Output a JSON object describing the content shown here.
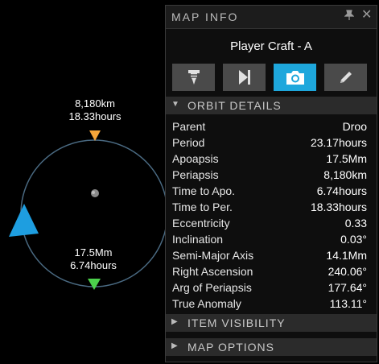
{
  "map": {
    "periapsis_label": {
      "distance": "8,180km",
      "time": "18.33hours"
    },
    "apoapsis_label": {
      "distance": "17.5Mm",
      "time": "6.74hours"
    },
    "colors": {
      "orbit_line": "#4a6a82",
      "periapsis_marker": "#f5a53a",
      "apoapsis_marker": "#4cd14c",
      "craft_marker": "#1e9ee0"
    }
  },
  "panel": {
    "title": "MAP INFO",
    "pin_icon": "pin-icon",
    "close_icon": "close-icon",
    "craft_name": "Player Craft - A",
    "tools": [
      {
        "icon": "drill-icon",
        "active": false
      },
      {
        "icon": "skip-forward-icon",
        "active": false
      },
      {
        "icon": "camera-icon",
        "active": true
      },
      {
        "icon": "pencil-icon",
        "active": false
      }
    ],
    "sections": {
      "orbit_details": "ORBIT DETAILS",
      "item_visibility": "ITEM VISIBILITY",
      "map_options": "MAP OPTIONS"
    },
    "orbit_rows": [
      {
        "label": "Parent",
        "value": "Droo"
      },
      {
        "label": "Period",
        "value": "23.17hours"
      },
      {
        "label": "Apoapsis",
        "value": "17.5Mm"
      },
      {
        "label": "Periapsis",
        "value": "8,180km"
      },
      {
        "label": "Time to Apo.",
        "value": "6.74hours"
      },
      {
        "label": "Time to Per.",
        "value": "18.33hours"
      },
      {
        "label": "Eccentricity",
        "value": "0.33"
      },
      {
        "label": "Inclination",
        "value": "0.03°"
      },
      {
        "label": "Semi-Major Axis",
        "value": "14.1Mm"
      },
      {
        "label": "Right Ascension",
        "value": "240.06°"
      },
      {
        "label": "Arg of Periapsis",
        "value": "177.64°"
      },
      {
        "label": "True Anomaly",
        "value": "113.11°"
      }
    ]
  }
}
